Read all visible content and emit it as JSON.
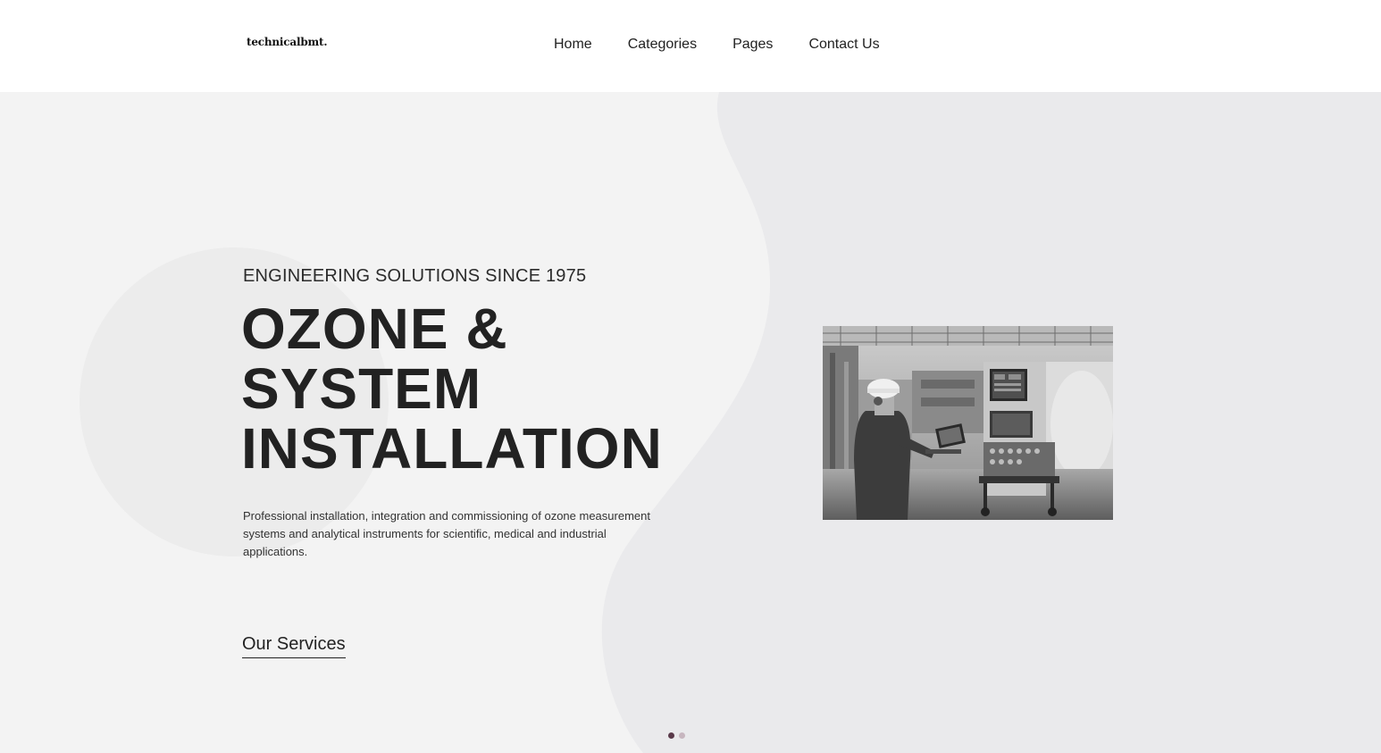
{
  "header": {
    "logo": "technicalbmt.",
    "nav": [
      {
        "label": "Home"
      },
      {
        "label": "Categories"
      },
      {
        "label": "Pages"
      },
      {
        "label": "Contact Us"
      }
    ]
  },
  "hero": {
    "eyebrow": "ENGINEERING SOLUTIONS SINCE 1975",
    "headline": [
      "OZONE &",
      "SYSTEM",
      "INSTALLATION"
    ],
    "description": "Professional installation, integration and commissioning of ozone measurement systems and analytical instruments for scientific, medical and industrial applications.",
    "cta": "Our Services",
    "image_icon": "industrial-engineer-photo"
  },
  "slider": {
    "active_index": 0,
    "count": 2
  },
  "colors": {
    "hero_bg": "#f3f3f3",
    "blob": "#eaeaec",
    "text": "#222222",
    "dot_active": "#5a3a4a",
    "dot_inactive": "#c7b6bf"
  }
}
